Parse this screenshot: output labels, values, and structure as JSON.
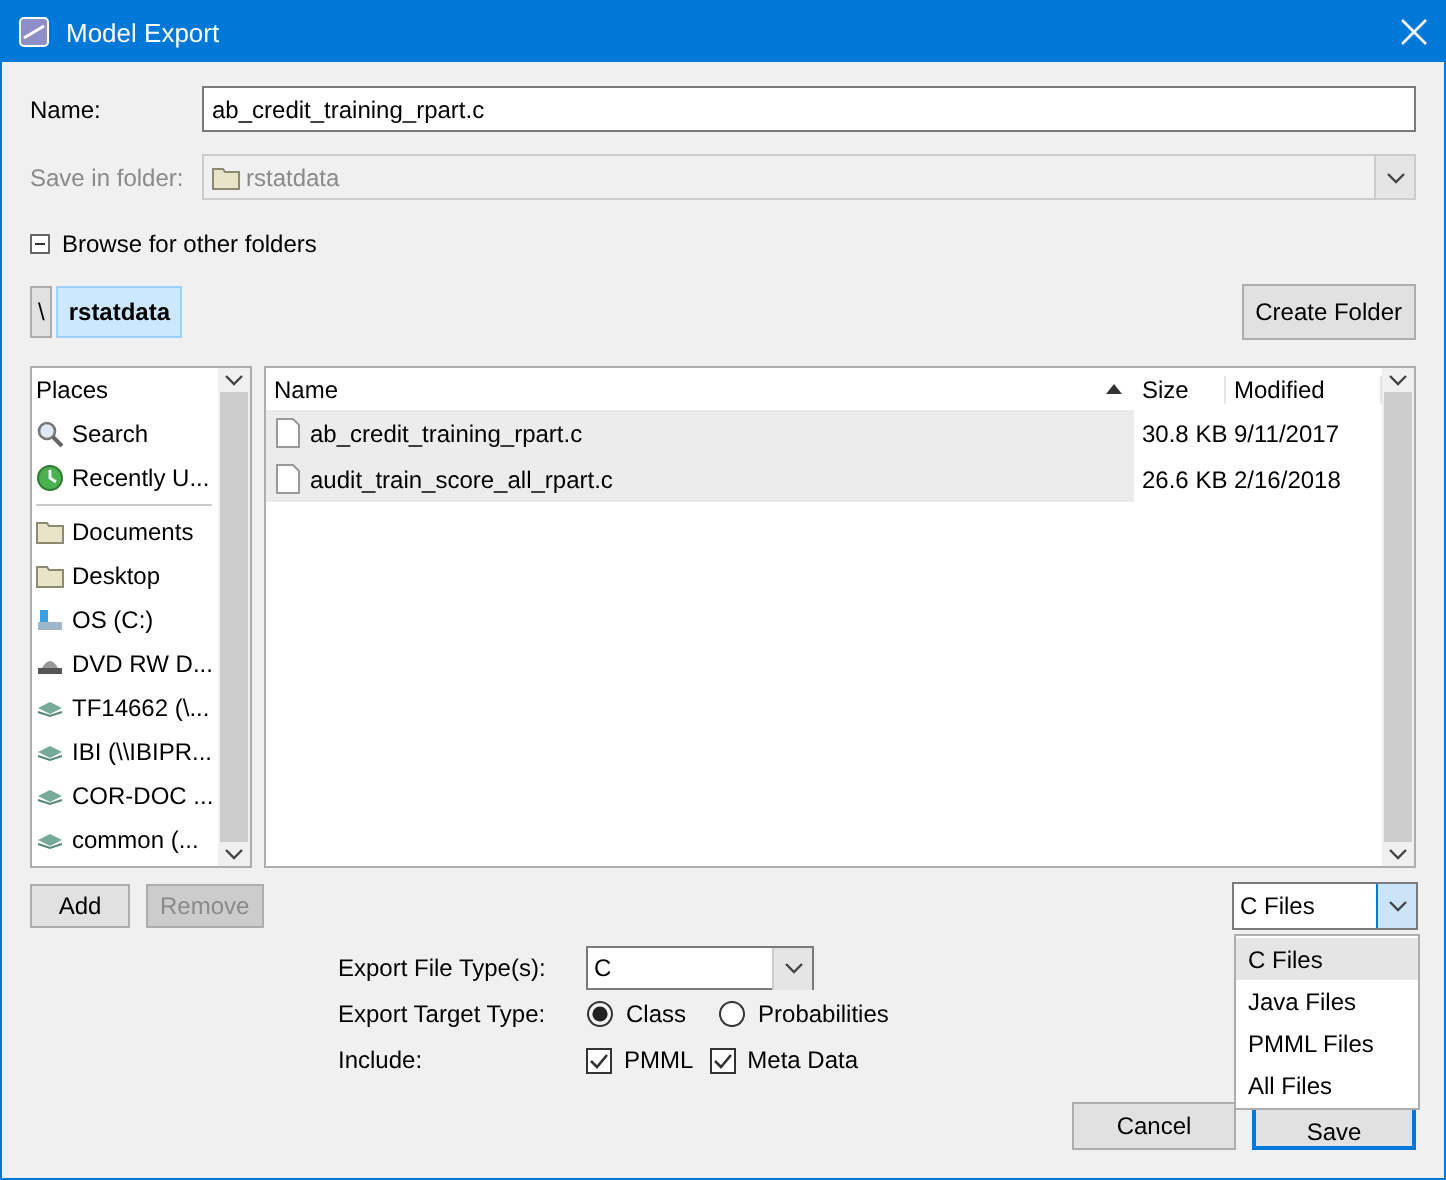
{
  "window": {
    "title": "Model Export"
  },
  "name_field": {
    "label": "Name:",
    "value": "ab_credit_training_rpart.c"
  },
  "save_in": {
    "label": "Save in folder:",
    "value": "rstatdata",
    "disabled": true
  },
  "browse": {
    "label": "Browse for other folders",
    "expanded": true
  },
  "path": [
    {
      "label": "\\",
      "selected": false
    },
    {
      "label": "rstatdata",
      "selected": true
    }
  ],
  "create_folder": "Create Folder",
  "places": {
    "header": "Places",
    "sections": [
      [
        {
          "label": "Search",
          "kind": "search"
        },
        {
          "label": "Recently U...",
          "kind": "recent"
        }
      ],
      [
        {
          "label": "Documents",
          "kind": "folder"
        },
        {
          "label": "Desktop",
          "kind": "folder"
        },
        {
          "label": "OS (C:)",
          "kind": "drive"
        },
        {
          "label": "DVD RW D...",
          "kind": "optical"
        },
        {
          "label": "TF14662 (\\...",
          "kind": "network"
        },
        {
          "label": "IBI (\\\\IBIPR...",
          "kind": "network"
        },
        {
          "label": "COR-DOC ...",
          "kind": "network"
        },
        {
          "label": "common (...",
          "kind": "network"
        }
      ]
    ]
  },
  "table": {
    "columns": [
      {
        "label": "Name",
        "sorted": true
      },
      {
        "label": "Size",
        "sorted": false
      },
      {
        "label": "Modified",
        "sorted": false
      }
    ],
    "rows": [
      {
        "name": "ab_credit_training_rpart.c",
        "size": "30.8 KB",
        "modified": "9/11/2017"
      },
      {
        "name": "audit_train_score_all_rpart.c",
        "size": "26.6 KB",
        "modified": "2/16/2018"
      }
    ]
  },
  "place_buttons": [
    {
      "label": "Add",
      "disabled": false
    },
    {
      "label": "Remove",
      "disabled": true
    }
  ],
  "filter": {
    "value": "C Files",
    "expanded": true,
    "options": [
      {
        "label": "C Files",
        "selected": true
      },
      {
        "label": "Java Files",
        "selected": false
      },
      {
        "label": "PMML Files",
        "selected": false
      },
      {
        "label": "All Files",
        "selected": false
      }
    ]
  },
  "export_file_type": {
    "label": "Export File Type(s):",
    "value": "C"
  },
  "target_type": {
    "label": "Export Target Type:",
    "options": [
      {
        "label": "Class",
        "selected": true
      },
      {
        "label": "Probabilities",
        "selected": false
      }
    ]
  },
  "include": {
    "label": "Include:",
    "options": [
      {
        "label": "PMML",
        "checked": true
      },
      {
        "label": "Meta Data",
        "checked": true
      }
    ]
  },
  "buttons": [
    {
      "label": "Cancel",
      "default": false
    },
    {
      "label": "Save",
      "default": true
    }
  ]
}
